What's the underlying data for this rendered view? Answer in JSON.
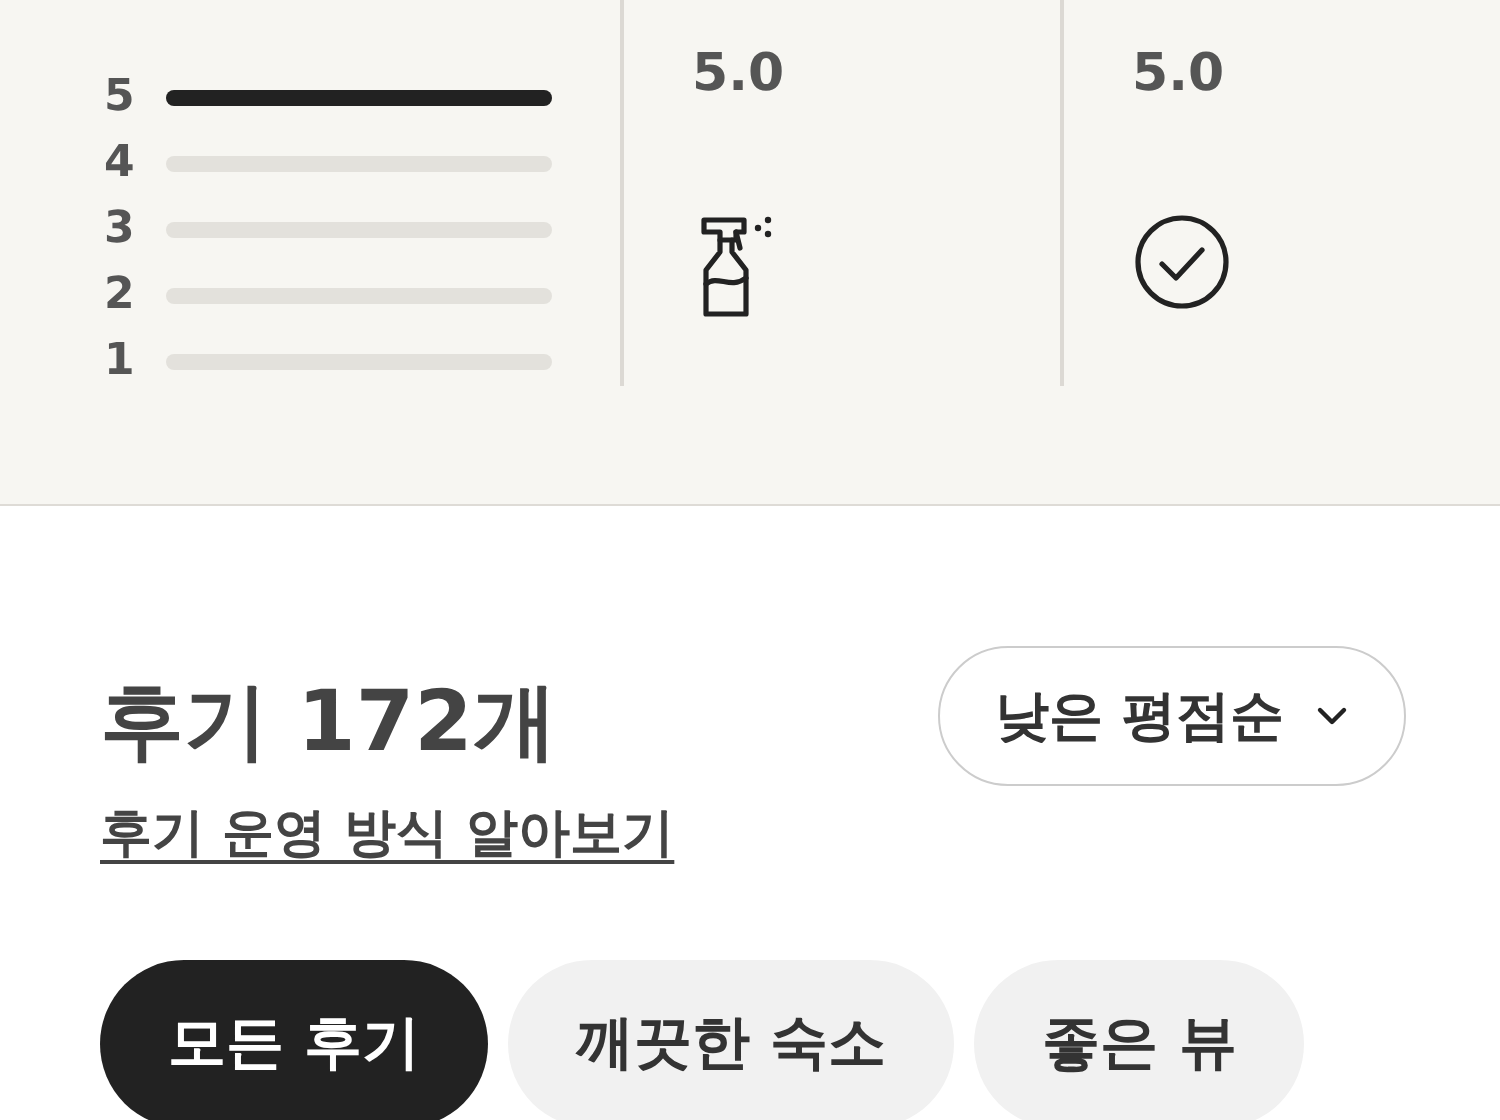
{
  "rating_distribution": [
    {
      "label": "5",
      "level": 1.0
    },
    {
      "label": "4",
      "level": 0
    },
    {
      "label": "3",
      "level": 0
    },
    {
      "label": "2",
      "level": 0
    },
    {
      "label": "1",
      "level": 0
    }
  ],
  "categories": [
    {
      "score": "5.0",
      "kind": "spray"
    },
    {
      "score": "5.0",
      "kind": "check"
    }
  ],
  "reviews": {
    "title": "후기 172개",
    "policy_link": "후기 운영 방식 알아보기",
    "sort": "낮은 평점순"
  },
  "filters": [
    {
      "label": "모든 후기",
      "selected": true
    },
    {
      "label": "깨끗한 숙소",
      "selected": false
    },
    {
      "label": "좋은 뷰",
      "selected": false
    }
  ]
}
